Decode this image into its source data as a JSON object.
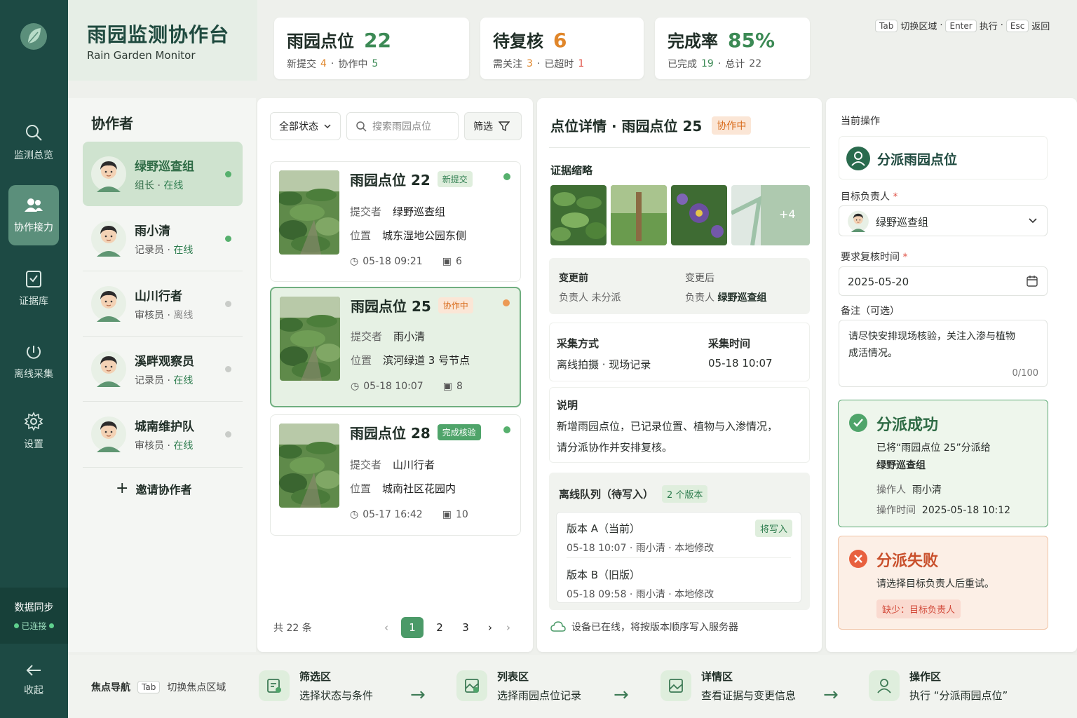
{
  "colors": {
    "brand": "#1d4a44",
    "accent": "#4b9a68",
    "warning": "#e89a50",
    "danger": "#e0554a"
  },
  "rail": {
    "items": [
      {
        "label": "监测总览",
        "icon": "search-icon"
      },
      {
        "label": "协作接力",
        "icon": "users-icon"
      },
      {
        "label": "证据库",
        "icon": "clipboard-icon"
      },
      {
        "label": "离线采集",
        "icon": "offline-icon"
      },
      {
        "label": "设置",
        "icon": "gear-icon"
      }
    ],
    "sync_title": "数据同步",
    "sync_status": "已连接",
    "collapse": "收起"
  },
  "brand": {
    "title": "雨园监测协作台",
    "subtitle": "Rain Garden Monitor"
  },
  "stats": [
    {
      "title": "雨园点位",
      "value": "22",
      "sub": [
        {
          "k": "新提交",
          "v": "4"
        },
        {
          "k": "协作中",
          "v": "5"
        }
      ]
    },
    {
      "title": "待复核",
      "value": "6",
      "sub": [
        {
          "k": "需关注",
          "v": "3"
        },
        {
          "k": "已超时",
          "v": "1"
        }
      ]
    },
    {
      "title": "完成率",
      "value": "85%",
      "sub": [
        {
          "k": "已完成",
          "v": "19"
        },
        {
          "k": "总计",
          "v": "22"
        }
      ]
    }
  ],
  "shortcuts": [
    {
      "key": "Tab",
      "label": "切换区域"
    },
    {
      "key": "Enter",
      "label": "执行"
    },
    {
      "key": "Esc",
      "label": "返回"
    }
  ],
  "collaborators": {
    "title": "协作者",
    "people": [
      {
        "name": "绿野巡查组",
        "role": "组长",
        "status": "在线",
        "online": true
      },
      {
        "name": "雨小清",
        "role": "记录员",
        "status": "在线",
        "online": true
      },
      {
        "name": "山川行者",
        "role": "审核员",
        "status": "离线",
        "online": false
      },
      {
        "name": "溪畔观察员",
        "role": "记录员",
        "status": "在线",
        "online": true
      },
      {
        "name": "城南维护队",
        "role": "审核员",
        "status": "在线",
        "online": true
      }
    ],
    "invite": "邀请协作者"
  },
  "list": {
    "status_select": "全部状态",
    "search_placeholder": "搜索雨园点位",
    "filter": "筛选",
    "items": [
      {
        "title": "雨园点位 22",
        "tag": "新提交",
        "submitter_label": "提交者",
        "submitter": "绿野巡查组",
        "loc_label": "位置",
        "location": "城东湿地公园东侧",
        "time": "05-18 09:21",
        "photos": "6"
      },
      {
        "title": "雨园点位 25",
        "tag": "协作中",
        "submitter_label": "提交者",
        "submitter": "雨小清",
        "loc_label": "位置",
        "location": "滨河绿道 3 号节点",
        "time": "05-18 10:07",
        "photos": "8"
      },
      {
        "title": "雨园点位 28",
        "tag": "完成核验",
        "submitter_label": "提交者",
        "submitter": "山川行者",
        "loc_label": "位置",
        "location": "城南社区花园内",
        "time": "05-17 16:42",
        "photos": "10"
      }
    ],
    "total": "共 22 条",
    "pages": [
      "1",
      "2",
      "3"
    ],
    "current_page": "1"
  },
  "detail": {
    "title": "点位详情 · 雨园点位 25",
    "tag": "协作中",
    "evidence_title": "证据缩略",
    "more": "+4",
    "before_label": "变更前",
    "before_k": "负责人",
    "before_v": "未分派",
    "after_label": "变更后",
    "after_k": "负责人",
    "after_v": "绿野巡查组",
    "method_label": "采集方式",
    "method_value": "离线拍摄 · 现场记录",
    "time_label": "采集时间",
    "time_value": "05-18 10:07",
    "desc_label": "说明",
    "desc_line1": "新增雨园点位，已记录位置、植物与入渗情况，",
    "desc_line2": "请分派协作并安排复核。",
    "queue_title": "离线队列（待写入）",
    "queue_count": "2 个版本",
    "versions": [
      {
        "name": "版本 A（当前）",
        "meta": "05-18 10:07 · 雨小清 · 本地修改",
        "badge": "将写入"
      },
      {
        "name": "版本 B（旧版）",
        "meta": "05-18 09:58 · 雨小清 · 本地修改"
      }
    ],
    "online_note": "设备已在线，将按版本顺序写入服务器"
  },
  "ops": {
    "section": "当前操作",
    "action": "分派雨园点位",
    "assignee_label": "目标负责人",
    "assignee": "绿野巡查组",
    "date_label": "要求复核时间",
    "date": "2025-05-20",
    "note_label": "备注（可选）",
    "note_line1": "请尽快安排现场核验，关注入渗与植物",
    "note_line2": "成活情况。",
    "note_count": "0/100",
    "success_title": "分派成功",
    "success_line1": "已将“雨园点位 25”分派给",
    "success_line2": "绿野巡查组",
    "success_op_k": "操作人",
    "success_op_v": "雨小清",
    "success_time_k": "操作时间",
    "success_time_v": "2025-05-18 10:12",
    "fail_title": "分派失败",
    "fail_msg": "请选择目标负责人后重试。",
    "fail_tag": "缺少：目标负责人"
  },
  "focus_nav": {
    "title": "焦点导航",
    "key": "Tab",
    "key_label": "切换焦点区域",
    "steps": [
      {
        "title": "筛选区",
        "desc": "选择状态与条件"
      },
      {
        "title": "列表区",
        "desc": "选择雨园点位记录"
      },
      {
        "title": "详情区",
        "desc": "查看证据与变更信息"
      },
      {
        "title": "操作区",
        "desc": "执行 “分派雨园点位”"
      }
    ]
  }
}
